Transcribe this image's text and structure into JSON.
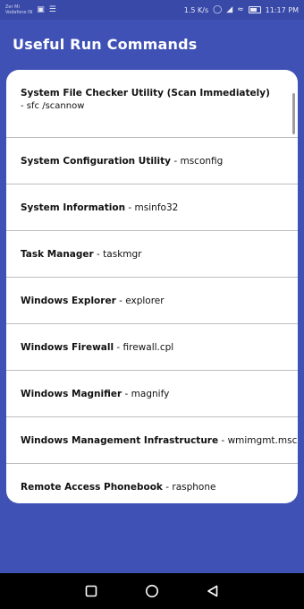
{
  "status_bar": {
    "carrier_line1": "Zer Mi",
    "carrier_line2": "Vodafone IN",
    "speed": "1.5 K/s",
    "time": "11:17 PM",
    "icons": [
      "sim-icon",
      "gallery-icon",
      "menu-icon",
      "alarm-icon",
      "signal-icon",
      "wifi-icon",
      "battery-icon"
    ]
  },
  "app_bar": {
    "title": "Useful Run Commands"
  },
  "commands": [
    {
      "name": "System File Checker Utility (Scan Immediately)",
      "separator": "",
      "command": "- sfc /scannow"
    },
    {
      "name": "System Configuration Utility",
      "separator": " - ",
      "command": "msconfig"
    },
    {
      "name": "System Information",
      "separator": " - ",
      "command": "msinfo32"
    },
    {
      "name": "Task Manager",
      "separator": " - ",
      "command": "taskmgr"
    },
    {
      "name": "Windows Explorer",
      "separator": " - ",
      "command": "explorer"
    },
    {
      "name": "Windows Firewall",
      "separator": " - ",
      "command": "firewall.cpl"
    },
    {
      "name": "Windows Magnifier",
      "separator": " - ",
      "command": "magnify"
    },
    {
      "name": "Windows Management Infrastructure",
      "separator": " - ",
      "command": "wmimgmt.msc"
    },
    {
      "name": "Remote Access Phonebook",
      "separator": " - ",
      "command": "rasphone"
    },
    {
      "name": "",
      "separator": "",
      "command": ""
    }
  ],
  "nav_bar": {
    "buttons": [
      "recents-square-icon",
      "home-circle-icon",
      "back-triangle-icon"
    ]
  },
  "colors": {
    "primary": "#3f51b5",
    "status_bar": "#3949a8",
    "card": "#ffffff",
    "divider": "#bdbdbd"
  }
}
